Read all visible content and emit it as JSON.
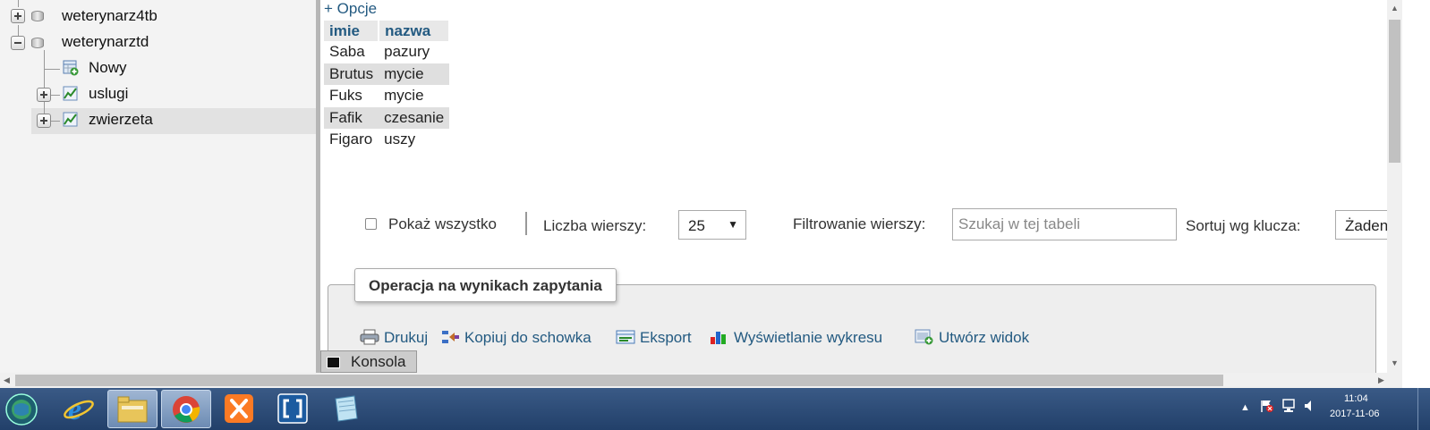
{
  "sidebar": {
    "databases": [
      {
        "name": "weterynarz4tb",
        "expanded": false
      },
      {
        "name": "weterynarztd",
        "expanded": true
      }
    ],
    "children": [
      {
        "label": "Nowy",
        "icon": "new-table-icon"
      },
      {
        "label": "uslugi",
        "icon": "table-icon"
      },
      {
        "label": "zwierzeta",
        "icon": "table-icon",
        "selected": true
      }
    ]
  },
  "results": {
    "options_link": "+ Opcje",
    "columns": [
      "imie",
      "nazwa"
    ],
    "rows": [
      [
        "Saba",
        "pazury"
      ],
      [
        "Brutus",
        "mycie"
      ],
      [
        "Fuks",
        "mycie"
      ],
      [
        "Fafik",
        "czesanie"
      ],
      [
        "Figaro",
        "uszy"
      ]
    ]
  },
  "controls": {
    "show_all_label": "Pokaż wszystko",
    "rows_label": "Liczba wierszy:",
    "rows_value": "25",
    "filter_label": "Filtrowanie wierszy:",
    "filter_placeholder": "Szukaj w tej tabeli",
    "sort_label": "Sortuj wg klucza:",
    "sort_value": "Żaden"
  },
  "operations": {
    "legend": "Operacja na wynikach zapytania",
    "items": [
      {
        "label": "Drukuj",
        "icon": "print-icon"
      },
      {
        "label": "Kopiuj do schowka",
        "icon": "clipboard-icon"
      },
      {
        "label": "Eksport",
        "icon": "export-icon"
      },
      {
        "label": "Wyświetlanie wykresu",
        "icon": "chart-icon"
      },
      {
        "label": "Utwórz widok",
        "icon": "view-icon"
      }
    ]
  },
  "console": {
    "label": "Konsola"
  },
  "taskbar": {
    "time": "11:04",
    "date": "2017-11-06"
  }
}
